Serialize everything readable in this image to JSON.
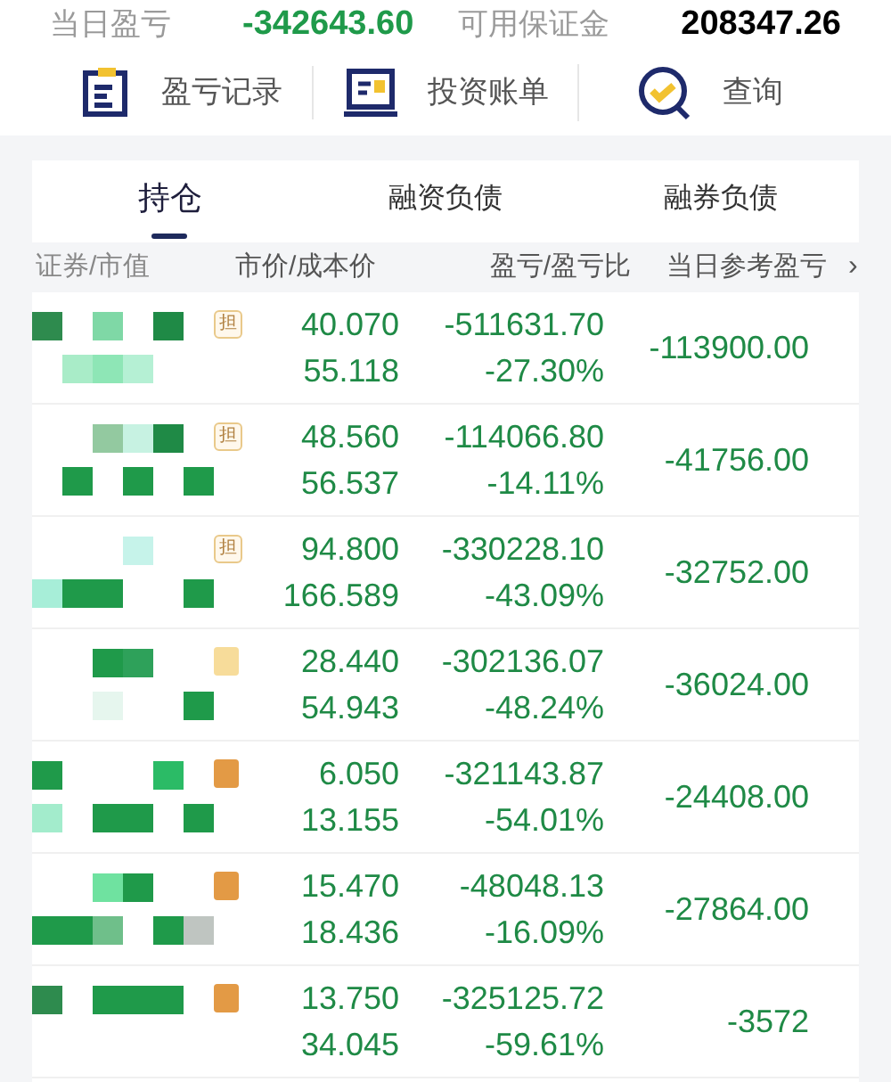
{
  "summary": [
    {
      "label": "当日盈亏",
      "value": "-342643.60",
      "color": "#1f9a4a"
    },
    {
      "label": "可用保证金",
      "value": "208347.26",
      "color": "#000000"
    }
  ],
  "actions": [
    {
      "kind": "record",
      "label": "盈亏记录"
    },
    {
      "kind": "bill",
      "label": "投资账单"
    },
    {
      "kind": "query",
      "label": "查询"
    }
  ],
  "tabs": [
    {
      "label": "持仓",
      "selected": true
    },
    {
      "label": "融资负债",
      "selected": false
    },
    {
      "label": "融券负债",
      "selected": false
    }
  ],
  "columns": [
    "证券/市值",
    "市价/成本价",
    "盈亏/盈亏比",
    "当日参考盈亏"
  ],
  "more_columns": "›",
  "rows": [
    {
      "badge": {
        "kind": "text",
        "text": "担",
        "color": "#e9c98a"
      },
      "price": "40.070",
      "cost": "55.118",
      "pnl": "-511631.70",
      "ratio": "-27.30%",
      "daily": "-113900.00"
    },
    {
      "badge": {
        "kind": "text",
        "text": "担",
        "color": "#e9c98a"
      },
      "price": "48.560",
      "cost": "56.537",
      "pnl": "-114066.80",
      "ratio": "-14.11%",
      "daily": "-41756.00"
    },
    {
      "badge": {
        "kind": "text",
        "text": "担",
        "color": "#e9c98a"
      },
      "price": "94.800",
      "cost": "166.589",
      "pnl": "-330228.10",
      "ratio": "-43.09%",
      "daily": "-32752.00"
    },
    {
      "badge": {
        "kind": "blank",
        "color": "#f7dc9a"
      },
      "price": "28.440",
      "cost": "54.943",
      "pnl": "-302136.07",
      "ratio": "-48.24%",
      "daily": "-36024.00"
    },
    {
      "badge": {
        "kind": "blank",
        "color": "#e39a45"
      },
      "price": "6.050",
      "cost": "13.155",
      "pnl": "-321143.87",
      "ratio": "-54.01%",
      "daily": "-24408.00"
    },
    {
      "badge": {
        "kind": "blank",
        "color": "#e39a45"
      },
      "price": "15.470",
      "cost": "18.436",
      "pnl": "-48048.13",
      "ratio": "-16.09%",
      "daily": "-27864.00"
    },
    {
      "badge": {
        "kind": "blank",
        "color": "#e39a45"
      },
      "price": "13.750",
      "cost": "34.045",
      "pnl": "-325125.72",
      "ratio": "-59.61%",
      "daily": "-3572"
    }
  ]
}
